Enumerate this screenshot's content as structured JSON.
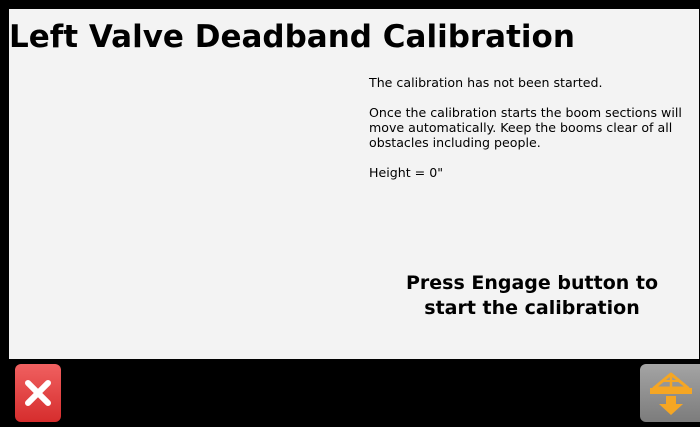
{
  "page": {
    "title": "Left Valve Deadband Calibration"
  },
  "info": {
    "status": "The calibration has not been started.",
    "warning": "Once the calibration starts the boom sections will move automatically. Keep the booms clear of all obstacles including people.",
    "height": "Height = 0\""
  },
  "prompt": {
    "line1": "Press Engage button to",
    "line2": "start the calibration"
  },
  "buttons": {
    "cancel": {
      "icon": "close-icon",
      "color": "#e04040"
    },
    "engage": {
      "icon": "boom-lower-icon",
      "color": "#f5a623"
    }
  }
}
